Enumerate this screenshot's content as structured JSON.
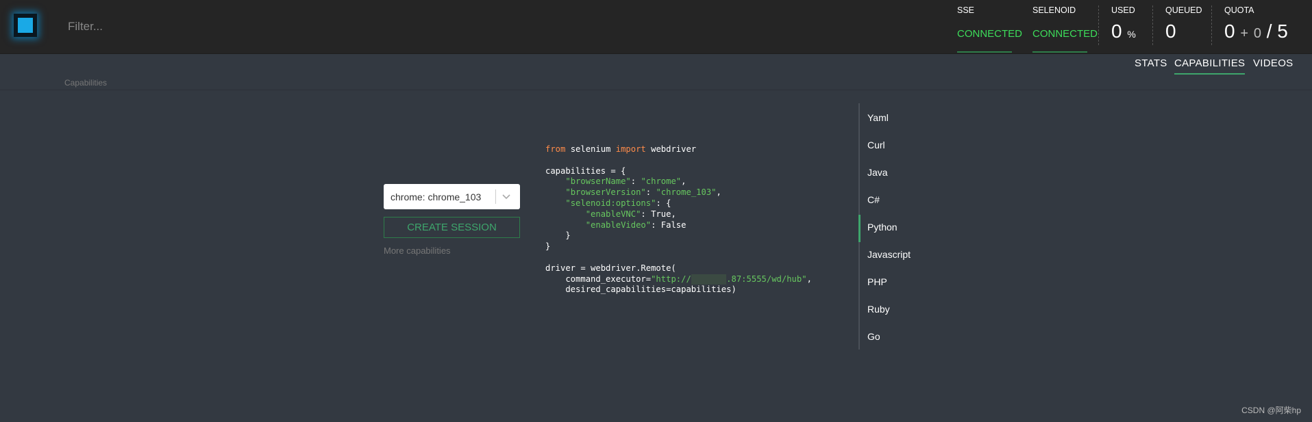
{
  "header": {
    "filter_placeholder": "Filter...",
    "stats": {
      "sse": {
        "label": "SSE",
        "value": "CONNECTED"
      },
      "selenoid": {
        "label": "SELENOID",
        "value": "CONNECTED"
      },
      "used": {
        "label": "USED",
        "value": "0",
        "unit": "%"
      },
      "queued": {
        "label": "QUEUED",
        "value": "0"
      },
      "quota": {
        "label": "QUOTA",
        "value": "0",
        "plus": "+",
        "pending": "0",
        "slash": "/",
        "total": "5"
      }
    }
  },
  "nav": {
    "breadcrumb": "Capabilities",
    "tabs": [
      {
        "label": "STATS",
        "active": false
      },
      {
        "label": "CAPABILITIES",
        "active": true
      },
      {
        "label": "VIDEOS",
        "active": false
      }
    ]
  },
  "session": {
    "browser_select": "chrome: chrome_103",
    "create_button": "CREATE SESSION",
    "more_link": "More capabilities"
  },
  "code": {
    "language": "Python",
    "lines": [
      "from selenium import webdriver",
      "",
      "capabilities = {",
      "    \"browserName\": \"chrome\",",
      "    \"browserVersion\": \"chrome_103\",",
      "    \"selenoid:options\": {",
      "        \"enableVNC\": True,",
      "        \"enableVideo\": False",
      "    }",
      "}",
      "",
      "driver = webdriver.Remote(",
      "    command_executor=\"http://        .87:5555/wd/hub\",",
      "    desired_capabilities=capabilities)"
    ],
    "url_suffix": ".87:5555/wd/hub"
  },
  "languages": [
    "Yaml",
    "Curl",
    "Java",
    "C#",
    "Python",
    "Javascript",
    "PHP",
    "Ruby",
    "Go"
  ],
  "active_language": "Python",
  "watermark": "CSDN @阿柴hp",
  "colors": {
    "background": "#333941",
    "topbar": "#252525",
    "connected": "#3ddc5a",
    "accent": "#3ea66c",
    "keyword": "#ff8c4a",
    "string": "#67c75f",
    "logo": "#1aa9e6"
  }
}
